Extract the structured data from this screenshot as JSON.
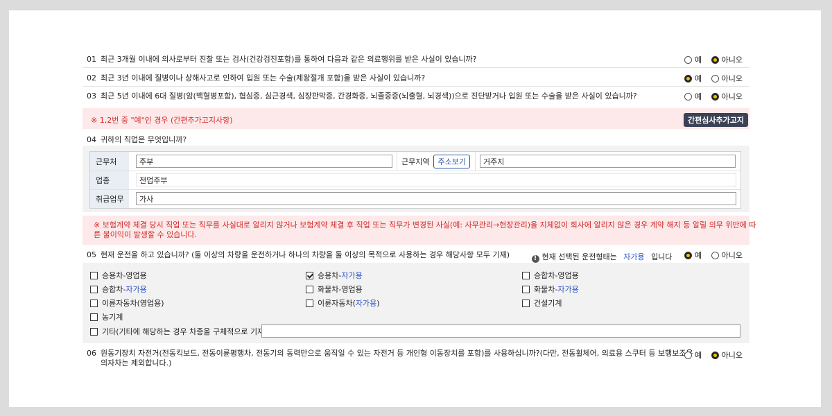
{
  "questions": {
    "q1": {
      "num": "01",
      "text": "최근 3개월 이내에 의사로부터 진찰 또는 검사(건강검진포함)를 통하여 다음과 같은 의료행위를 받은 사실이 있습니까?",
      "yes": "예",
      "no": "아니오",
      "selected": "no"
    },
    "q2": {
      "num": "02",
      "text": "최근 3년 이내에 질병이나 상해사고로 인하여 입원 또는 수술(제왕절개 포함)을 받은 사실이 있습니까?",
      "yes": "예",
      "no": "아니오",
      "selected": "yes"
    },
    "q3": {
      "num": "03",
      "text": "최근 5년 이내에 6대 질병(암(백혈병포함), 협심증, 심근경색, 심장판막증, 간경화증, 뇌졸중증(뇌출혈, 뇌경색))으로 진단받거나 입원 또는 수술을 받은 사실이 있습니까?",
      "yes": "예",
      "no": "아니오",
      "selected": "no"
    },
    "notice12": {
      "text": "※ 1,2번 중 \"예\"인 경우 (간편추가고지사항)",
      "button": "간편심사추가고지"
    },
    "q4": {
      "num": "04",
      "text": "귀하의 직업은 무엇입니까?",
      "workplace_label": "근무처",
      "workplace_value": "주부",
      "region_label": "근무지역",
      "address_button": "주소보기",
      "region_value": "거주지",
      "industry_label": "업종",
      "industry_value": "전업주부",
      "duty_label": "취급업무",
      "duty_value": "가사"
    },
    "warning": {
      "line1": "※ 보험계약 체결 당시 직업 또는 직무를 사실대로 알리지 않거나 보험계약 체결 후 직업 또는 직무가 변경된 사실(예: 사무관리→현장관리)을 지체없이 회사에 알리지 않은 경우 계약 해지 등 알릴 의무 위반에 따",
      "line2": "른 불이익이 발생할 수 있습니다."
    },
    "q5": {
      "num": "05",
      "text": "현재 운전을 하고 있습니까? (둘 이상의 차량을 운전하거나 하나의 차량을 둘 이상의 목적으로 사용하는 경우 해당사항 모두 기재)",
      "info_pre": "현재 선택된 운전형태는",
      "info_value": "자가용",
      "info_post": "입니다",
      "yes": "예",
      "no": "아니오",
      "selected": "yes",
      "options": {
        "o1": {
          "a": "승용차-영업용",
          "b": "",
          "checked": false
        },
        "o2": {
          "a": "승용차-",
          "b": "자가용",
          "checked": true
        },
        "o3": {
          "a": "승합차-영업용",
          "b": "",
          "checked": false
        },
        "o4": {
          "a": "승합차-",
          "b": "자가용",
          "checked": false
        },
        "o5": {
          "a": "화물차-영업용",
          "b": "",
          "checked": false
        },
        "o6": {
          "a": "화물차-",
          "b": "자가용",
          "checked": false
        },
        "o7": {
          "a": "이륜자동차(영업용)",
          "b": "",
          "checked": false
        },
        "o8": {
          "a": "이륜자동차(",
          "b": "자가용",
          "c": ")",
          "checked": false
        },
        "o9": {
          "a": "건설기계",
          "b": "",
          "checked": false
        },
        "o10": {
          "a": "농기계",
          "b": "",
          "checked": false
        },
        "o11": {
          "a": "기타(기타에 해당하는 경우 차종을 구체적으로 기재)",
          "b": "",
          "checked": false
        }
      },
      "other_value": ""
    },
    "q6": {
      "num": "06",
      "line1": "원동기장치 자전거(전동킥보드, 전동이륜평행차, 전동기의 동력만으로 움직일 수 있는 자전거 등 개인형 이동장치를 포함)를 사용하십니까?(다만, 전동휠체어, 의료용 스쿠터 등 보행보조용",
      "line2": "의자차는 제외합니다.)",
      "yes": "예",
      "no": "아니오",
      "selected": "no"
    }
  },
  "colors": {
    "accent": "#f2c200",
    "notice_bg": "#fde9e9",
    "notice_text": "#d32a2a",
    "link_blue": "#2a55c8",
    "dark_button": "#3b4256"
  }
}
